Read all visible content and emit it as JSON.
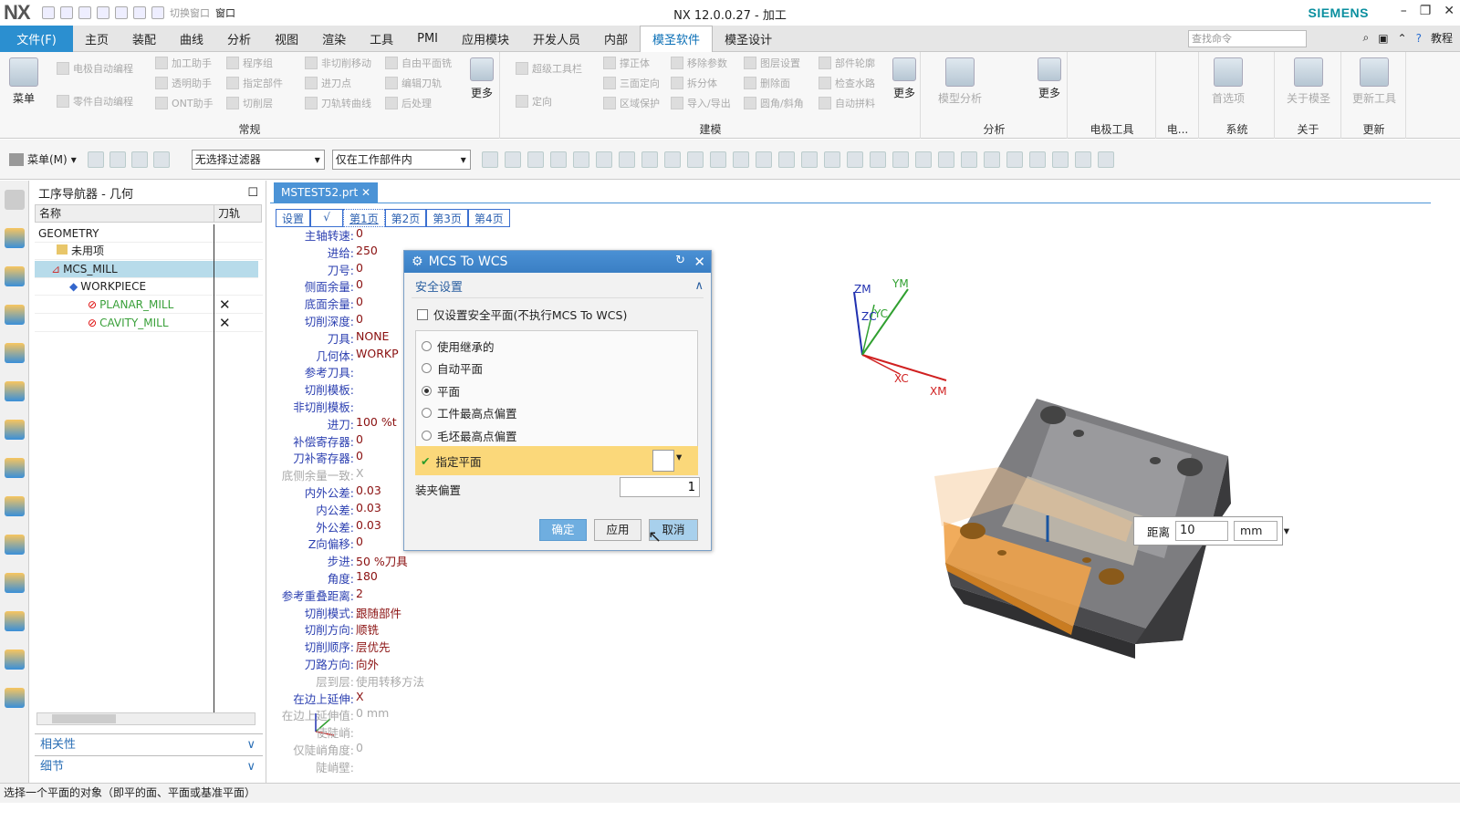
{
  "app": {
    "logo": "NX",
    "title": "NX 12.0.0.27 - 加工",
    "brand": "SIEMENS",
    "qa_switch_window": "切换窗口",
    "qa_window": "窗口"
  },
  "menubar": {
    "file": "文件(F)",
    "tabs": [
      "主页",
      "装配",
      "曲线",
      "分析",
      "视图",
      "渲染",
      "工具",
      "PMI",
      "应用模块",
      "开发人员",
      "内部",
      "模圣软件",
      "模圣设计"
    ],
    "active_tab": "模圣软件",
    "search_placeholder": "查找命令",
    "tutorial": "教程"
  },
  "ribbon": {
    "menu_btn": "菜单",
    "more1": "更多",
    "more2": "更多",
    "more3": "更多",
    "group_regular": "常规",
    "group_model": "建模",
    "group_analysis": "分析",
    "group_electrode": "电极工具",
    "group_elec2": "电...",
    "group_system": "系统",
    "group_about": "关于",
    "group_update": "更新",
    "items_a": [
      "电极自动编程",
      "零件自动编程"
    ],
    "items_b": [
      "加工助手",
      "透明助手",
      "ONT助手"
    ],
    "items_c": [
      "程序组",
      "指定部件",
      "切削层"
    ],
    "items_d": [
      "非切削移动",
      "进刀点",
      "刀轨转曲线"
    ],
    "items_e": [
      "自由平面铣",
      "编辑刀轨",
      "后处理"
    ],
    "items_f": [
      "超级工具栏",
      "定向"
    ],
    "items_g": [
      "撑正体",
      "三面定向",
      "区域保护"
    ],
    "items_h": [
      "移除参数",
      "拆分体",
      "导入/导出"
    ],
    "items_i": [
      "图层设置",
      "删除面",
      "圆角/斜角"
    ],
    "items_j": [
      "部件轮廓",
      "检查水路",
      "自动拼料"
    ],
    "model_analysis": "模型分析",
    "preferences": "首选项",
    "about_mosheng": "关于模圣",
    "update_tool": "更新工具"
  },
  "toolbar2": {
    "menu": "菜单(M)",
    "filter": "无选择过滤器",
    "scope": "仅在工作部件内"
  },
  "navigator": {
    "title": "工序导航器 - 几何",
    "col_name": "名称",
    "col_path": "刀轨",
    "rows": [
      "GEOMETRY",
      "未用项",
      "MCS_MILL",
      "WORKPIECE",
      "PLANAR_MILL",
      "CAVITY_MILL"
    ],
    "related": "相关性",
    "details": "细节"
  },
  "document": {
    "tab": "MSTEST52.prt",
    "pages": [
      "设置",
      "√",
      "第1页",
      "第2页",
      "第3页",
      "第4页"
    ]
  },
  "params": [
    {
      "k": "主轴转速:",
      "v": "0"
    },
    {
      "k": "进给:",
      "v": "250"
    },
    {
      "k": "刀号:",
      "v": "0"
    },
    {
      "k": "侧面余量:",
      "v": "0"
    },
    {
      "k": "底面余量:",
      "v": "0"
    },
    {
      "k": "切削深度:",
      "v": "0"
    },
    {
      "k": "刀具:",
      "v": "NONE"
    },
    {
      "k": "几何体:",
      "v": "WORKP"
    },
    {
      "k": "参考刀具:",
      "v": ""
    },
    {
      "k": "切削模板:",
      "v": ""
    },
    {
      "k": "非切削模板:",
      "v": ""
    },
    {
      "k": "进刀:",
      "v": "100   %t"
    },
    {
      "k": "补偿寄存器:",
      "v": "0"
    },
    {
      "k": "刀补寄存器:",
      "v": "0"
    },
    {
      "k": "底侧余量一致:",
      "v": "X"
    },
    {
      "k": "内外公差:",
      "v": "0.03"
    },
    {
      "k": "内公差:",
      "v": "0.03"
    },
    {
      "k": "外公差:",
      "v": "0.03"
    },
    {
      "k": "Z向偏移:",
      "v": "0"
    },
    {
      "k": "步进:",
      "v": "50    %刀具"
    },
    {
      "k": "角度:",
      "v": "180"
    },
    {
      "k": "参考重叠距离:",
      "v": "2"
    },
    {
      "k": "切削模式:",
      "v": "跟随部件"
    },
    {
      "k": "切削方向:",
      "v": "顺铣"
    },
    {
      "k": "切削顺序:",
      "v": "层优先"
    },
    {
      "k": "刀路方向:",
      "v": "向外"
    },
    {
      "k": "层到层:",
      "v": "使用转移方法"
    },
    {
      "k": "在边上延伸:",
      "v": "X"
    },
    {
      "k": "在边上延伸值:",
      "v": "0      mm"
    },
    {
      "k": "使陡峭:",
      "v": ""
    },
    {
      "k": "仅陡峭角度:",
      "v": "0"
    },
    {
      "k": "陡峭壁:",
      "v": ""
    }
  ],
  "dialog": {
    "title": "MCS To WCS",
    "section": "安全设置",
    "checkbox": "仅设置安全平面(不执行MCS To WCS)",
    "options": [
      "使用继承的",
      "自动平面",
      "平面",
      "工件最高点偏置",
      "毛坯最高点偏置"
    ],
    "selected": "平面",
    "specify_plane": "指定平面",
    "clamp_offset_label": "装夹偏置",
    "clamp_offset_value": "1",
    "ok": "确定",
    "apply": "应用",
    "cancel": "取消"
  },
  "distance": {
    "label": "距离",
    "value": "10",
    "unit": "mm"
  },
  "axes": {
    "zm": "ZM",
    "ym": "YM",
    "zc": "ZC",
    "yc": "YC",
    "xc": "XC",
    "xm": "XM"
  },
  "status": "选择一个平面的对象（即平的面、平面或基准平面）"
}
